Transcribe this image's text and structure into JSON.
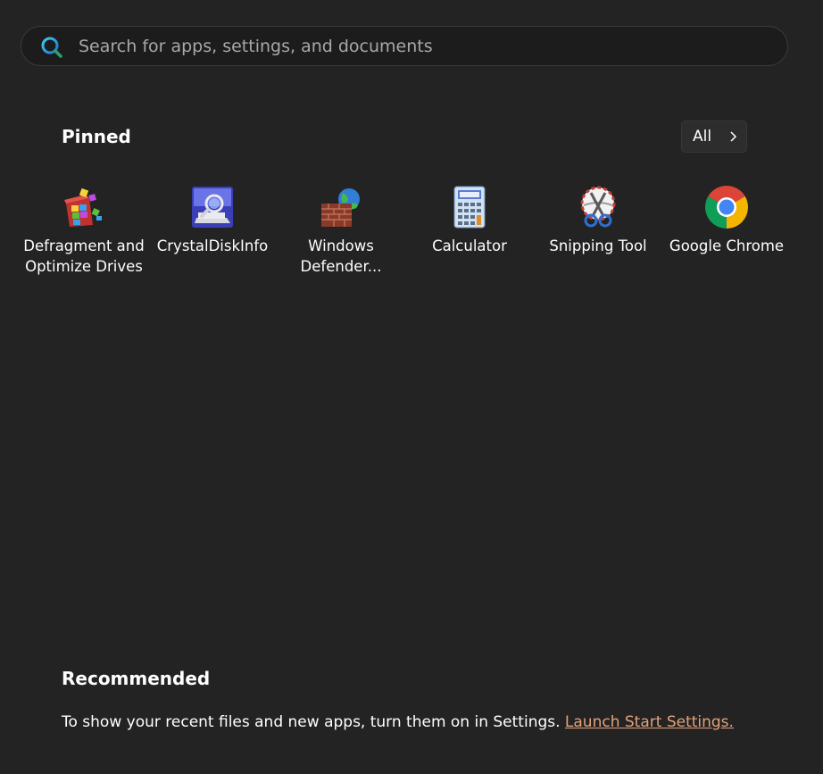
{
  "search": {
    "placeholder": "Search for apps, settings, and documents"
  },
  "pinned": {
    "title": "Pinned",
    "all_label": "All",
    "apps": [
      {
        "label": "Defragment and\nOptimize Drives",
        "icon": "defrag-icon"
      },
      {
        "label": "CrystalDiskInfo",
        "icon": "crystaldiskinfo-icon"
      },
      {
        "label": "Windows\nDefender...",
        "icon": "firewall-icon"
      },
      {
        "label": "Calculator",
        "icon": "calculator-icon"
      },
      {
        "label": "Snipping Tool",
        "icon": "snipping-tool-icon"
      },
      {
        "label": "Google Chrome",
        "icon": "chrome-icon"
      }
    ]
  },
  "recommended": {
    "title": "Recommended",
    "message": "To show your recent files and new apps, turn them on in Settings. ",
    "link_label": "Launch Start Settings."
  },
  "colors": {
    "background": "#232323",
    "link": "#e3a27a",
    "search_bg": "#1c1c1c"
  }
}
